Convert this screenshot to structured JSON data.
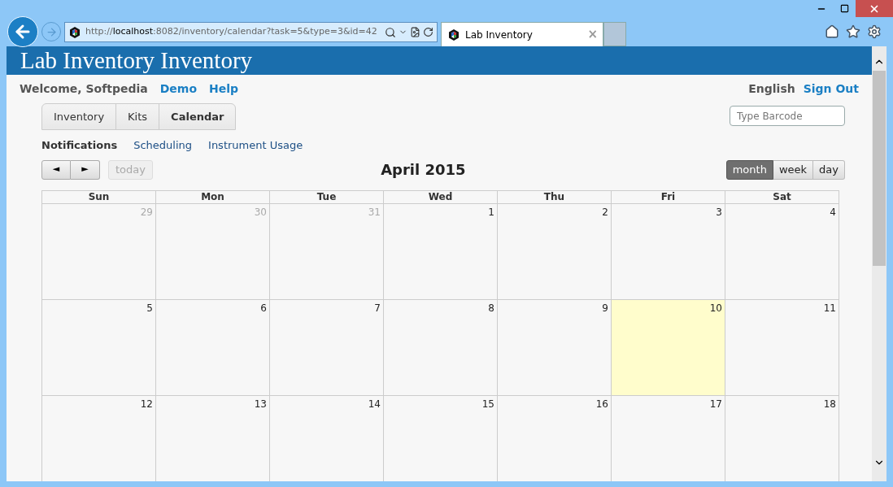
{
  "browser": {
    "url_scheme": "http://",
    "url_host": "localhost",
    "url_rest": ":8082/inventory/calendar?task=5&type=3&id=42",
    "tab": {
      "title": "Lab Inventory",
      "close": "×"
    }
  },
  "header": {
    "title": "Lab Inventory Inventory"
  },
  "user_bar": {
    "welcome": "Welcome, Softpedia",
    "links": [
      "Demo",
      "Help"
    ],
    "language": "English",
    "sign_out": "Sign Out"
  },
  "main_tabs": [
    {
      "label": "Inventory",
      "selected": false
    },
    {
      "label": "Kits",
      "selected": false
    },
    {
      "label": "Calendar",
      "selected": true
    }
  ],
  "barcode": {
    "placeholder": "Type Barcode"
  },
  "sub_nav": [
    {
      "label": "Notifications",
      "selected": true
    },
    {
      "label": "Scheduling",
      "selected": false
    },
    {
      "label": "Instrument Usage",
      "selected": false
    }
  ],
  "calendar": {
    "prev": "◄",
    "next": "►",
    "today": {
      "label": "today",
      "disabled": true
    },
    "title": "April 2015",
    "views": [
      {
        "label": "month",
        "selected": true
      },
      {
        "label": "week",
        "selected": false
      },
      {
        "label": "day",
        "selected": false
      }
    ],
    "weekdays": [
      "Sun",
      "Mon",
      "Tue",
      "Wed",
      "Thu",
      "Fri",
      "Sat"
    ],
    "weeks": [
      [
        {
          "day": "29",
          "other_month": true,
          "today": false
        },
        {
          "day": "30",
          "other_month": true,
          "today": false
        },
        {
          "day": "31",
          "other_month": true,
          "today": false
        },
        {
          "day": "1",
          "other_month": false,
          "today": false
        },
        {
          "day": "2",
          "other_month": false,
          "today": false
        },
        {
          "day": "3",
          "other_month": false,
          "today": false
        },
        {
          "day": "4",
          "other_month": false,
          "today": false
        }
      ],
      [
        {
          "day": "5",
          "other_month": false,
          "today": false
        },
        {
          "day": "6",
          "other_month": false,
          "today": false
        },
        {
          "day": "7",
          "other_month": false,
          "today": false
        },
        {
          "day": "8",
          "other_month": false,
          "today": false
        },
        {
          "day": "9",
          "other_month": false,
          "today": false
        },
        {
          "day": "10",
          "other_month": false,
          "today": true
        },
        {
          "day": "11",
          "other_month": false,
          "today": false
        }
      ],
      [
        {
          "day": "12",
          "other_month": false,
          "today": false
        },
        {
          "day": "13",
          "other_month": false,
          "today": false
        },
        {
          "day": "14",
          "other_month": false,
          "today": false
        },
        {
          "day": "15",
          "other_month": false,
          "today": false
        },
        {
          "day": "16",
          "other_month": false,
          "today": false
        },
        {
          "day": "17",
          "other_month": false,
          "today": false
        },
        {
          "day": "18",
          "other_month": false,
          "today": false
        }
      ]
    ]
  }
}
